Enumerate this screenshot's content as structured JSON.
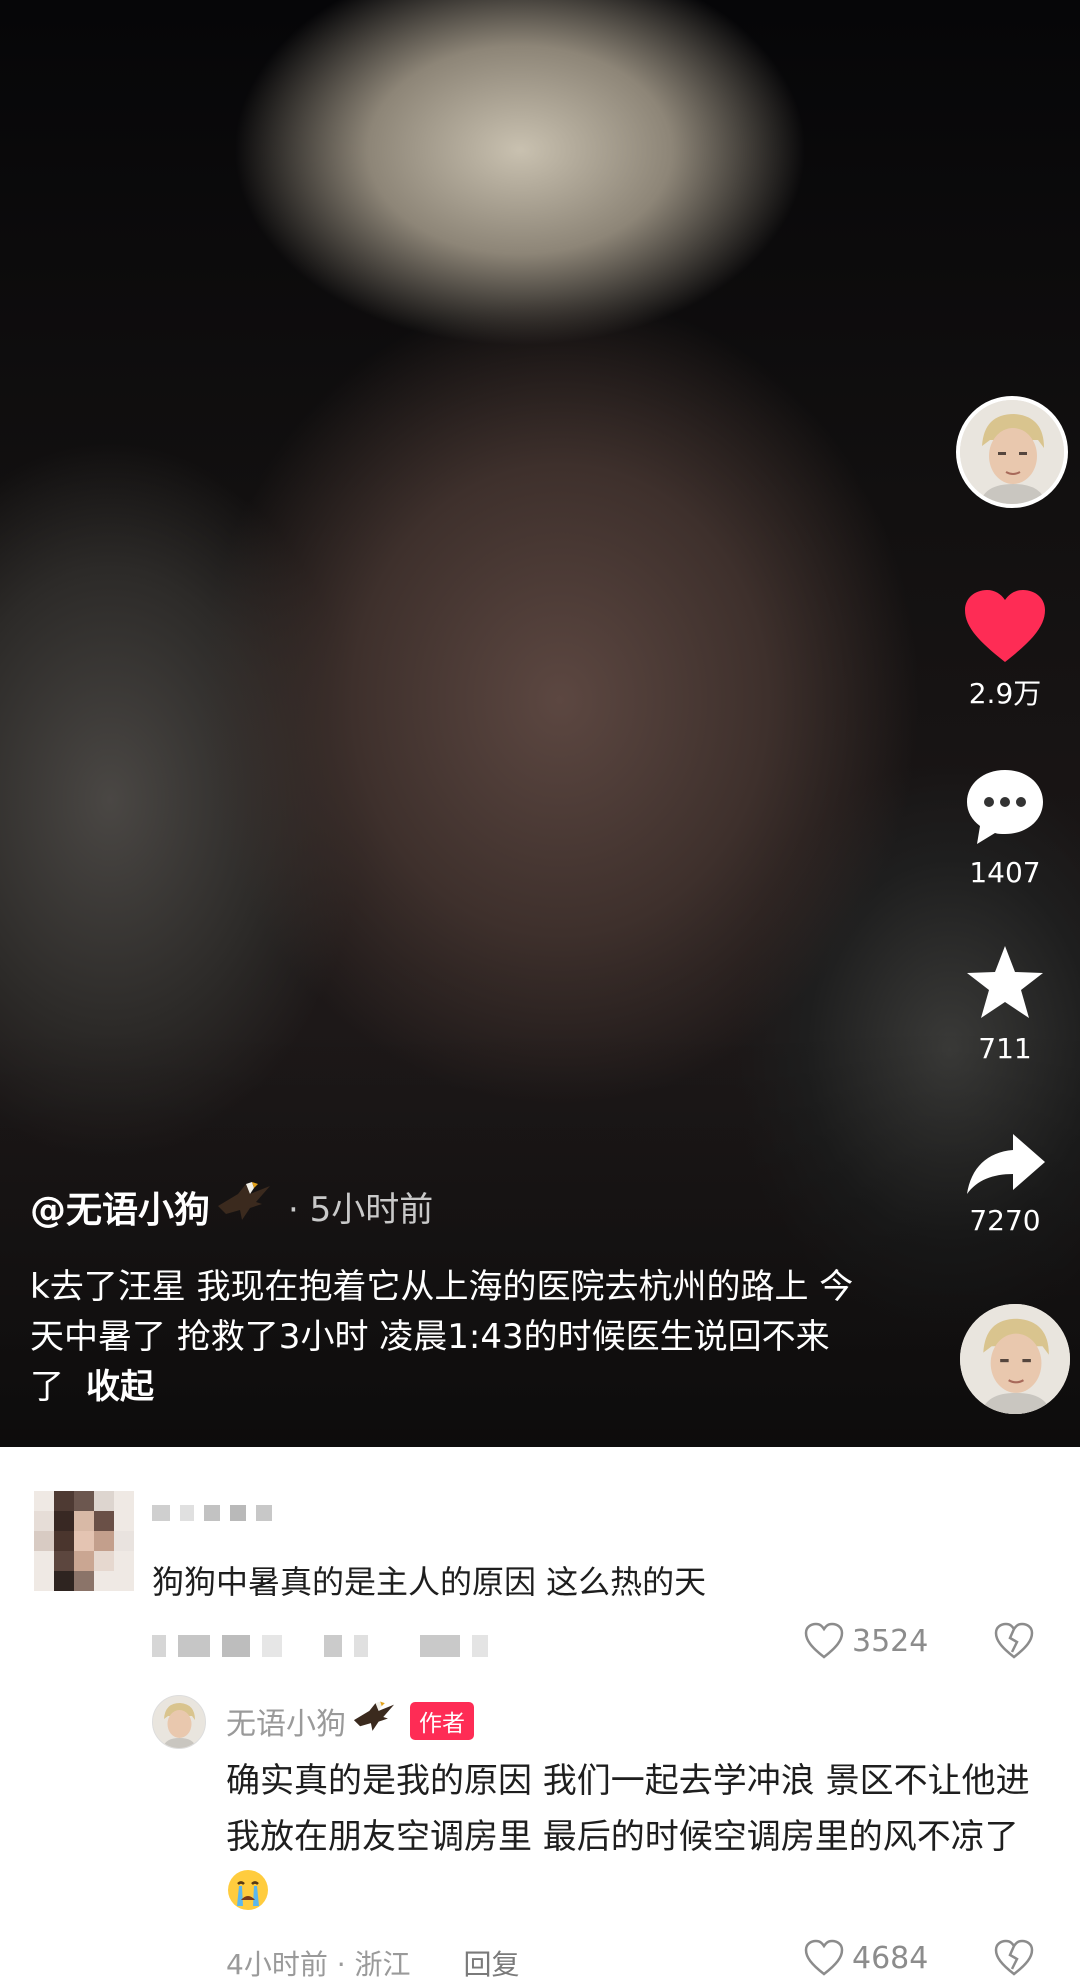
{
  "video": {
    "author_handle": "@无语小狗",
    "post_time": "5小时前",
    "caption": "k去了汪星 我现在抱着它从上海的医院去杭州的路上 今天中暑了 抢救了3小时 凌晨1:43的时候医生说回不来了",
    "collapse_label": "收起",
    "likes": "2.9万",
    "comments": "1407",
    "favorites": "711",
    "shares": "7270"
  },
  "comments": [
    {
      "text": "狗狗中暑真的是主人的原因 这么热的天",
      "like_count": "3524",
      "reply": {
        "author": "无语小狗",
        "author_badge": "作者",
        "text": "确实真的是我的原因 我们一起去学冲浪 景区不让他进 我放在朋友空调房里 最后的时候空调房里的风不凉了",
        "time_location": "4小时前 · 浙江",
        "reply_label": "回复",
        "like_count": "4684"
      }
    }
  ],
  "colors": {
    "like_red": "#fe2c55",
    "author_badge": "#fe2c55"
  },
  "icons": [
    "heart-icon",
    "comment-icon",
    "star-icon",
    "share-icon",
    "eagle-emoji-icon",
    "crying-emoji-icon",
    "outline-heart-icon",
    "broken-heart-icon"
  ]
}
